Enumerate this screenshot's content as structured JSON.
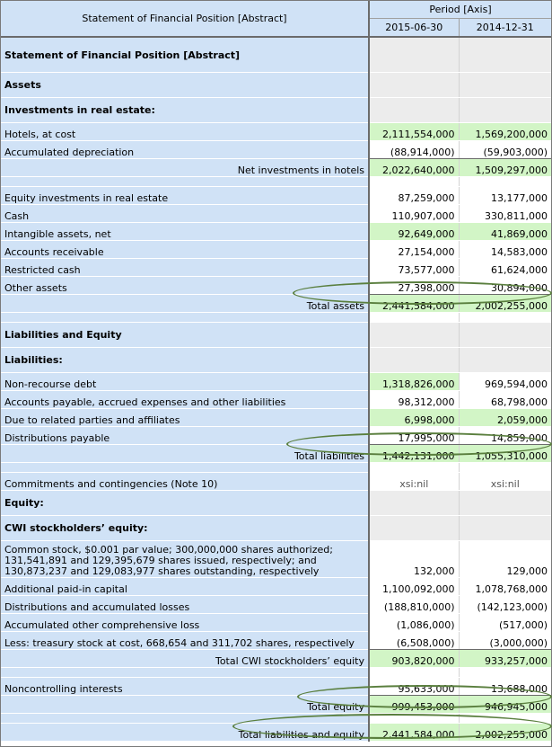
{
  "header": {
    "period_axis": "Period [Axis]",
    "abstract_label": "Statement of Financial Position [Abstract]",
    "col_a": "2015-06-30",
    "col_b": "2014-12-31"
  },
  "rows": {
    "r01": {
      "label": "Statement of Financial Position [Abstract]"
    },
    "r02": {
      "label": "Assets"
    },
    "r03": {
      "label": "Investments in real estate:"
    },
    "r04": {
      "label": "Hotels, at cost",
      "a": "2,111,554,000",
      "b": "1,569,200,000"
    },
    "r05": {
      "label": "Accumulated depreciation",
      "a": "(88,914,000)",
      "b": "(59,903,000)"
    },
    "r06": {
      "label": "Net investments in hotels",
      "a": "2,022,640,000",
      "b": "1,509,297,000"
    },
    "r07": {
      "label": "Equity investments in real estate",
      "a": "87,259,000",
      "b": "13,177,000"
    },
    "r08": {
      "label": "Cash",
      "a": "110,907,000",
      "b": "330,811,000"
    },
    "r09": {
      "label": "Intangible assets, net",
      "a": "92,649,000",
      "b": "41,869,000"
    },
    "r10": {
      "label": "Accounts receivable",
      "a": "27,154,000",
      "b": "14,583,000"
    },
    "r11": {
      "label": "Restricted cash",
      "a": "73,577,000",
      "b": "61,624,000"
    },
    "r12": {
      "label": "Other assets",
      "a": "27,398,000",
      "b": "30,894,000"
    },
    "r13": {
      "label": "Total assets",
      "a": "2,441,584,000",
      "b": "2,002,255,000"
    },
    "r14": {
      "label": "Liabilities and Equity"
    },
    "r15": {
      "label": "Liabilities:"
    },
    "r16": {
      "label": "Non-recourse debt",
      "a": "1,318,826,000",
      "b": "969,594,000"
    },
    "r17": {
      "label": "Accounts payable, accrued expenses and other liabilities",
      "a": "98,312,000",
      "b": "68,798,000"
    },
    "r18": {
      "label": "Due to related parties and affiliates",
      "a": "6,998,000",
      "b": "2,059,000"
    },
    "r19": {
      "label": "Distributions payable",
      "a": "17,995,000",
      "b": "14,859,000"
    },
    "r20": {
      "label": "Total liabilities",
      "a": "1,442,131,000",
      "b": "1,055,310,000"
    },
    "r21": {
      "label": "Commitments and contingencies (Note 10)",
      "a": "xsi:nil",
      "b": "xsi:nil"
    },
    "r22": {
      "label": "Equity:"
    },
    "r23": {
      "label": "CWI stockholders’ equity:"
    },
    "r24": {
      "label": "Common stock, $0.001 par value; 300,000,000 shares authorized; 131,541,891 and 129,395,679 shares issued, respectively; and 130,873,237 and 129,083,977 shares outstanding, respectively",
      "a": "132,000",
      "b": "129,000"
    },
    "r25": {
      "label": "Additional paid-in capital",
      "a": "1,100,092,000",
      "b": "1,078,768,000"
    },
    "r26": {
      "label": "Distributions and accumulated losses",
      "a": "(188,810,000)",
      "b": "(142,123,000)"
    },
    "r27": {
      "label": "Accumulated other comprehensive loss",
      "a": "(1,086,000)",
      "b": "(517,000)"
    },
    "r28": {
      "label": "Less: treasury stock at cost, 668,654 and 311,702 shares, respectively",
      "a": "(6,508,000)",
      "b": "(3,000,000)"
    },
    "r29": {
      "label": "Total CWI stockholders’ equity",
      "a": "903,820,000",
      "b": "933,257,000"
    },
    "r30": {
      "label": "Noncontrolling interests",
      "a": "95,633,000",
      "b": "13,688,000"
    },
    "r31": {
      "label": "Total equity",
      "a": "999,453,000",
      "b": "946,945,000"
    },
    "r32": {
      "label": "Total liabilities and equity",
      "a": "2,441,584,000",
      "b": "2,002,255,000"
    }
  },
  "colors": {
    "label_bg": "#d0e2f6",
    "highlight_green": "#d2f5c6",
    "empty_grey": "#ececec",
    "oval": "#5a7f3e"
  }
}
